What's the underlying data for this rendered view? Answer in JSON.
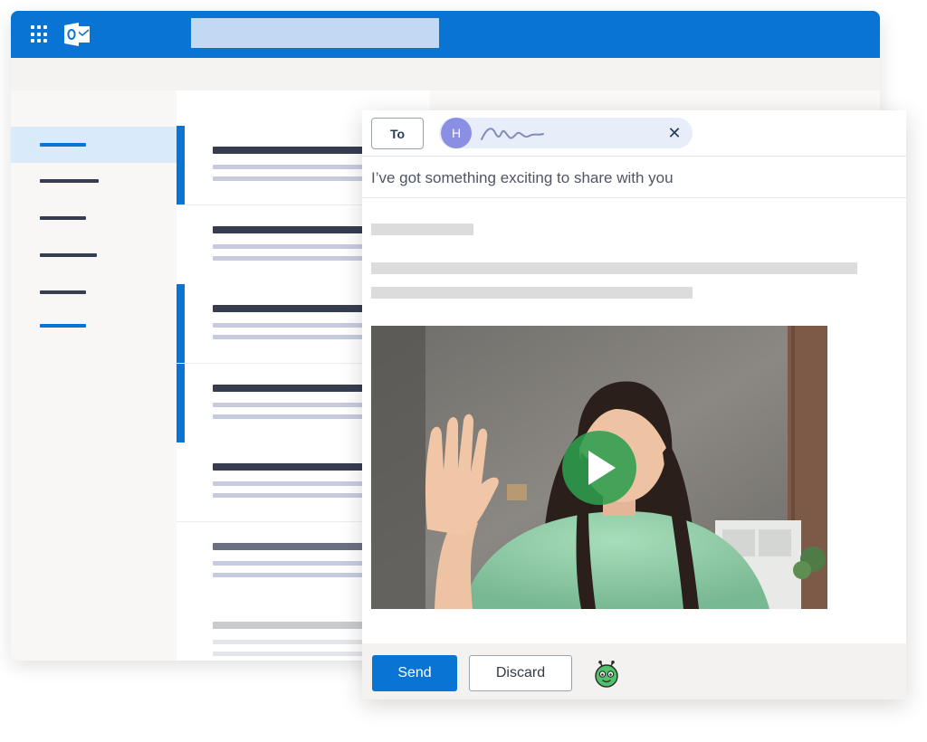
{
  "compose": {
    "to_label": "To",
    "recipient_initial": "H",
    "remove_recipient": "✕",
    "subject": "I’ve got something exciting to share with you",
    "send_label": "Send",
    "discard_label": "Discard"
  },
  "icons": {
    "app_launcher": "waffle-grid-icon",
    "app_logo": "outlook-logo-icon",
    "recipient_signature": "handwritten-signature",
    "video_play": "play-icon",
    "addin": "green-robot-icon"
  },
  "colors": {
    "brand_blue": "#0a74d4",
    "search_box": "#c1d9f3",
    "avatar": "#8b8fe3",
    "play_button": "#2e9e4f"
  }
}
